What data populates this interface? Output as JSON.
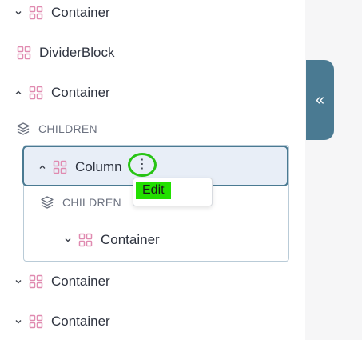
{
  "tree": {
    "items": [
      {
        "label": "Container",
        "chevron": "chevron-down-icon"
      },
      {
        "label": "DividerBlock"
      },
      {
        "label": "Container",
        "chevron": "chevron-up-icon"
      },
      {
        "children_label": "CHILDREN"
      },
      {
        "label": "Column",
        "chevron": "chevron-up-icon",
        "selected": true
      },
      {
        "children_label": "CHILDREN"
      },
      {
        "label": "Container",
        "chevron": "chevron-down-icon"
      },
      {
        "label": "Container",
        "chevron": "chevron-down-icon"
      },
      {
        "label": "Container",
        "chevron": "chevron-down-icon"
      }
    ]
  },
  "context_menu": {
    "more_icon": "⋮",
    "items": [
      {
        "label": "Edit"
      }
    ]
  },
  "collapse_tab": {
    "icon": "«"
  },
  "colors": {
    "accent": "#4a7a92",
    "selection_bg": "#e8eef7",
    "grid_icon": "#e08ab0",
    "highlight_green": "#22e000",
    "ring_green": "#28c414"
  }
}
